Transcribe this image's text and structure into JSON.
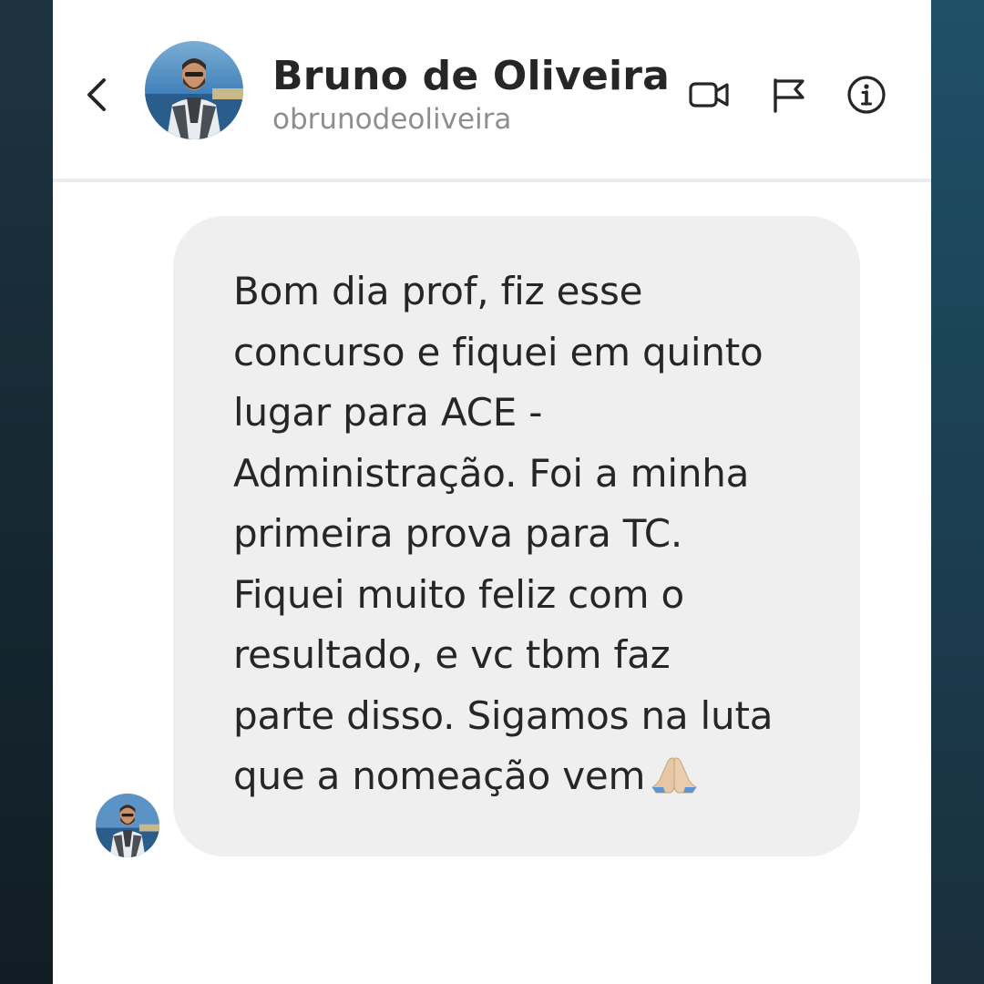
{
  "header": {
    "back_icon": "chevron-left-icon",
    "contact_name": "Bruno de Oliveira",
    "username": "obrunodeoliveira",
    "actions": [
      {
        "name": "video-call",
        "icon": "video-camera-icon"
      },
      {
        "name": "report",
        "icon": "flag-icon"
      },
      {
        "name": "info",
        "icon": "info-icon"
      }
    ]
  },
  "message": {
    "text": "Bom dia prof, fiz esse\nconcurso e fiquei em quinto\nlugar para ACE -\nAdministração. Foi a minha\nprimeira prova para TC.\nFiquei muito feliz com o\nresultado, e vc tbm faz\nparte disso. Sigamos na luta\nque a nomeação vem",
    "emoji": "praying-hands-icon"
  },
  "colors": {
    "bubble": "#efefef",
    "text": "#262626",
    "username": "#8e8e8e"
  }
}
